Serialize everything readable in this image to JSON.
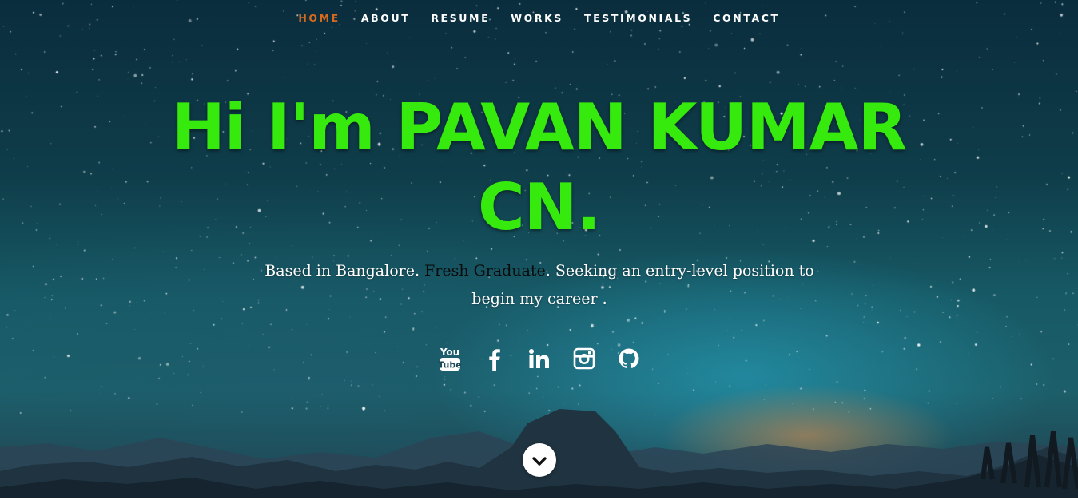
{
  "nav": {
    "items": [
      {
        "label": "HOME",
        "active": true
      },
      {
        "label": "ABOUT",
        "active": false
      },
      {
        "label": "RESUME",
        "active": false
      },
      {
        "label": "WORKS",
        "active": false
      },
      {
        "label": "TESTIMONIALS",
        "active": false
      },
      {
        "label": "CONTACT",
        "active": false
      }
    ]
  },
  "hero": {
    "headline": "Hi I'm PAVAN KUMAR CN.",
    "tagline_part1": "Based in Bangalore. ",
    "tagline_highlight": "Fresh Graduate",
    "tagline_part2": ". Seeking an entry-level position to begin my career ."
  },
  "social": [
    {
      "name": "youtube-icon"
    },
    {
      "name": "facebook-icon"
    },
    {
      "name": "linkedin-icon"
    },
    {
      "name": "instagram-icon"
    },
    {
      "name": "github-icon"
    }
  ],
  "colors": {
    "accent_nav": "#d86a1e",
    "headline": "#35ea0c",
    "highlight_text": "#0b0b0b"
  },
  "scroll_button": {
    "icon": "chevron-down-icon"
  }
}
